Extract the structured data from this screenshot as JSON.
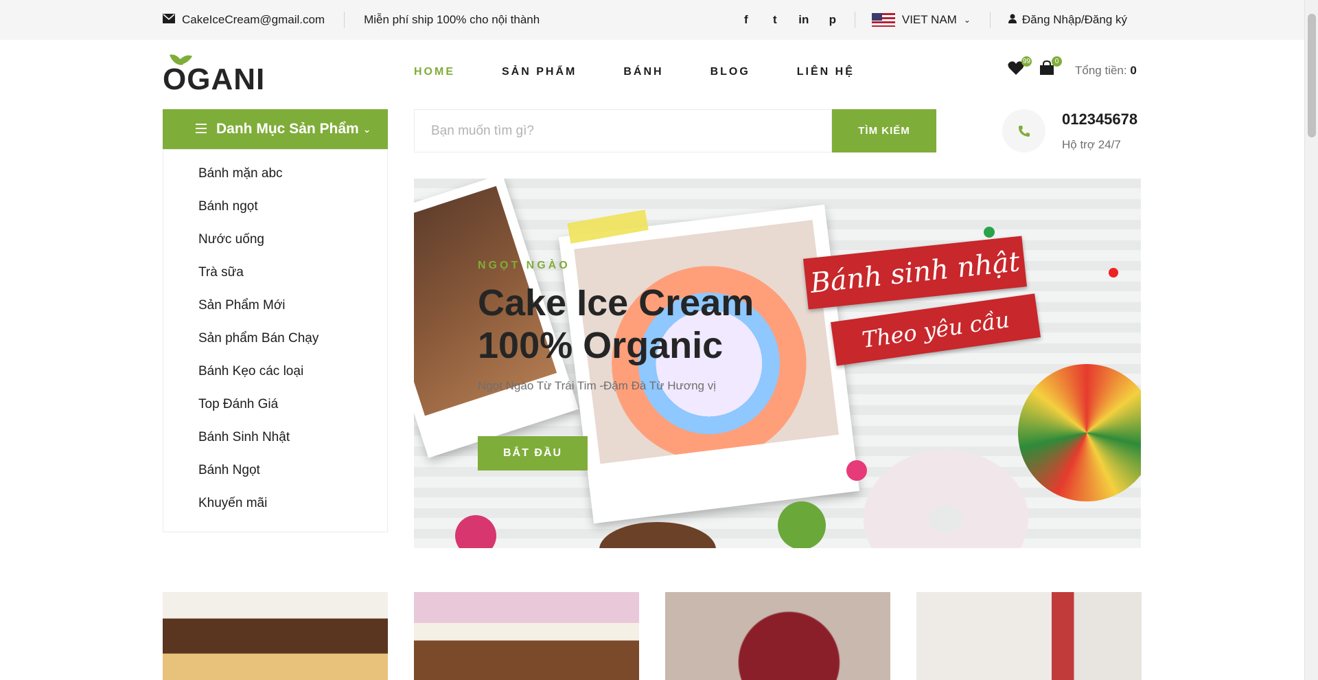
{
  "topbar": {
    "email": "CakeIceCream@gmail.com",
    "shipping": "Miễn phí ship 100% cho nội thành",
    "social": [
      {
        "name": "facebook-icon",
        "glyph": "f"
      },
      {
        "name": "twitter-icon",
        "glyph": "t"
      },
      {
        "name": "linkedin-icon",
        "glyph": "in"
      },
      {
        "name": "pinterest-icon",
        "glyph": "p"
      }
    ],
    "language": "VIET NAM",
    "login": "Đăng Nhập/Đăng ký"
  },
  "header": {
    "logo": "OGANI",
    "nav": [
      "HOME",
      "SẢN PHẨM",
      "BÁNH",
      "BLOG",
      "LIÊN HỆ"
    ],
    "wishlist_count": "99",
    "cart_count": "0",
    "total_label": "Tổng tiền:",
    "total_value": "0"
  },
  "categories": {
    "title": "Danh Mục Sản Phẩm",
    "items": [
      "Bánh mặn abc",
      "Bánh ngọt",
      "Nước uống",
      "Trà sữa",
      "Sản Phẩm Mới",
      "Sản phẩm Bán Chạy",
      "Bánh Kẹo các loại",
      "Top Đánh Giá",
      "Bánh Sinh Nhật",
      "Bánh Ngọt",
      "Khuyến mãi"
    ]
  },
  "search": {
    "placeholder": "Bạn muốn tìm gì?",
    "button": "TÌM KIẾM"
  },
  "support": {
    "phone": "012345678",
    "label": "Hộ trợ 24/7"
  },
  "hero": {
    "tag": "NGỌT NGÀO",
    "title_line1": "Cake Ice Cream",
    "title_line2": "100% Organic",
    "subtitle": "Ngọt Ngào Từ Trái Tim -Đậm Đà Từ Hương vị",
    "button": "BẮT ĐẦU",
    "ribbon_line1": "Bánh sinh nhật",
    "ribbon_line2": "Theo yêu cầu"
  },
  "colors": {
    "accent": "#7fad39",
    "topbar": "#f5f5f5",
    "text": "#1c1c1c"
  }
}
